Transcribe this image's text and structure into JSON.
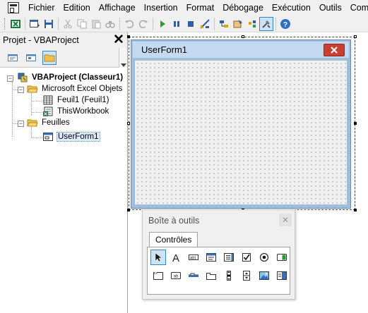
{
  "menu": {
    "items": [
      {
        "label": "Fichier"
      },
      {
        "label": "Edition"
      },
      {
        "label": "Affichage"
      },
      {
        "label": "Insertion"
      },
      {
        "label": "Format"
      },
      {
        "label": "Débogage"
      },
      {
        "label": "Exécution"
      },
      {
        "label": "Outils"
      },
      {
        "label": "Compl"
      }
    ]
  },
  "toolbar": {
    "icons": [
      "excel-view-icon",
      "insert-userform-icon",
      "save-icon",
      "cut-icon",
      "copy-icon",
      "paste-icon",
      "find-icon",
      "undo-icon",
      "redo-icon",
      "run-icon",
      "break-icon",
      "reset-icon",
      "design-mode-icon",
      "project-explorer-icon",
      "properties-icon",
      "object-browser-icon",
      "toolbox-icon",
      "help-icon"
    ]
  },
  "project_panel": {
    "title": "Projet - VBAProject",
    "close_glyph": "✕",
    "tree": {
      "root": "VBAProject (Classeur1)",
      "folder_excel": "Microsoft Excel Objets",
      "sheet1": "Feuil1 (Feuil1)",
      "workbook": "ThisWorkbook",
      "folder_forms": "Feuilles",
      "userform": "UserForm1"
    }
  },
  "userform": {
    "title": "UserForm1"
  },
  "toolbox": {
    "title": "Boîte à outils",
    "close_glyph": "✕",
    "tab": "Contrôles",
    "tools": [
      "pointer-tool-icon",
      "label-tool-icon",
      "textbox-tool-icon",
      "combobox-tool-icon",
      "listbox-tool-icon",
      "checkbox-tool-icon",
      "optionbutton-tool-icon",
      "togglebutton-tool-icon",
      "frame-tool-icon",
      "commandbutton-tool-icon",
      "tabstrip-tool-icon",
      "multipage-tool-icon",
      "scrollbar-tool-icon",
      "spinbutton-tool-icon",
      "image-tool-icon",
      "refedit-tool-icon"
    ]
  },
  "colors": {
    "form_frame": "#9fbedb",
    "form_title_bg": "#c5daf0",
    "close_button": "#c94030",
    "selection": "#cce4f7",
    "selection_border": "#3a84c6"
  }
}
